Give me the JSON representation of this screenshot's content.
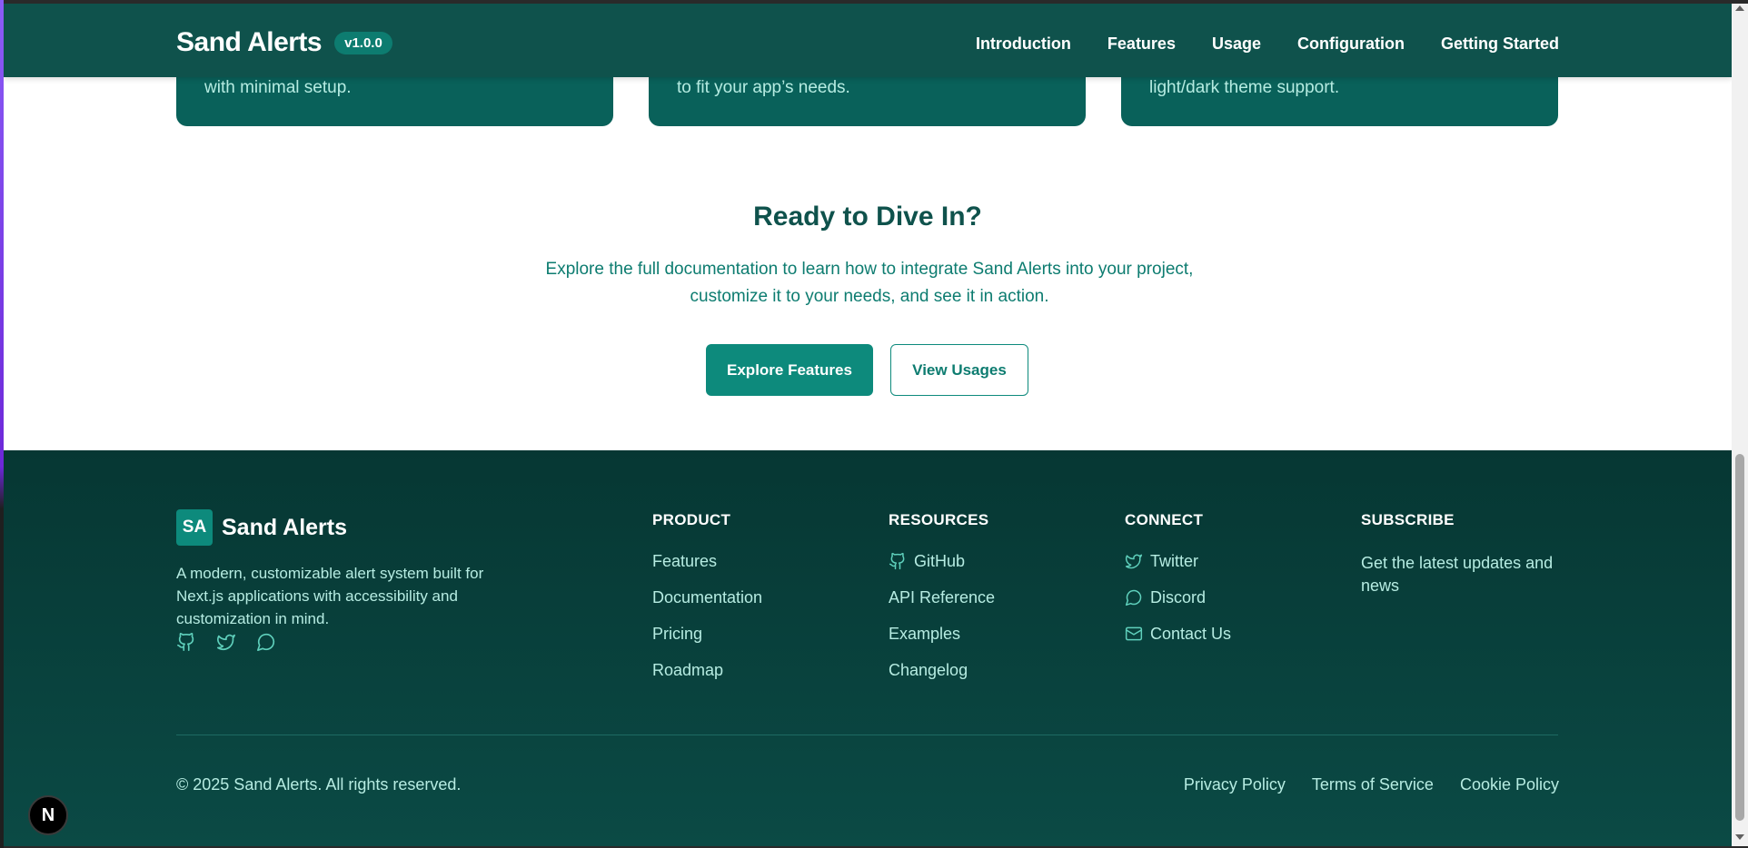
{
  "header": {
    "brand": "Sand Alerts",
    "version": "v1.0.0",
    "nav": [
      "Introduction",
      "Features",
      "Usage",
      "Configuration",
      "Getting Started"
    ]
  },
  "cards": [
    {
      "text": "with minimal setup."
    },
    {
      "text": "to fit your app’s needs."
    },
    {
      "text": "light/dark theme support."
    }
  ],
  "cta": {
    "title": "Ready to Dive In?",
    "text": "Explore the full documentation to learn how to integrate Sand Alerts into your project, customize it to your needs, and see it in action.",
    "primary_label": "Explore Features",
    "secondary_label": "View Usages"
  },
  "footer": {
    "logo_initials": "SA",
    "brand": "Sand Alerts",
    "description": "A modern, customizable alert system built for Next.js applications with accessibility and customization in mind.",
    "social_icons": [
      "github-icon",
      "twitter-icon",
      "discord-icon"
    ],
    "columns": {
      "product": {
        "heading": "PRODUCT",
        "links": [
          "Features",
          "Documentation",
          "Pricing",
          "Roadmap"
        ]
      },
      "resources": {
        "heading": "RESOURCES",
        "links": [
          "GitHub",
          "API Reference",
          "Examples",
          "Changelog"
        ]
      },
      "connect": {
        "heading": "CONNECT",
        "links": [
          "Twitter",
          "Discord",
          "Contact Us"
        ]
      },
      "subscribe": {
        "heading": "SUBSCRIBE",
        "text": "Get the latest updates and news"
      }
    },
    "copyright": "© 2025 Sand Alerts. All rights reserved.",
    "legal": [
      "Privacy Policy",
      "Terms of Service",
      "Cookie Policy"
    ]
  },
  "dev_badge": "N",
  "colors": {
    "header_bg": "#0f524c",
    "accent": "#0d8a7c",
    "footer_bg": "#063733",
    "footer_text": "#b6ece2"
  }
}
